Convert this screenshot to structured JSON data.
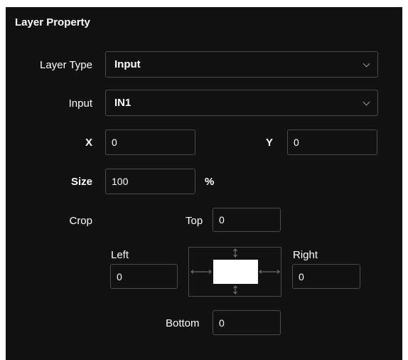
{
  "panel": {
    "title": "Layer Property"
  },
  "layer_type": {
    "label": "Layer Type",
    "value": "Input"
  },
  "input": {
    "label": "Input",
    "value": "IN1"
  },
  "x": {
    "label": "X",
    "value": "0"
  },
  "y": {
    "label": "Y",
    "value": "0"
  },
  "size": {
    "label": "Size",
    "value": "100",
    "unit": "%"
  },
  "crop": {
    "label": "Crop",
    "top": {
      "label": "Top",
      "value": "0"
    },
    "left": {
      "label": "Left",
      "value": "0"
    },
    "right": {
      "label": "Right",
      "value": "0"
    },
    "bottom": {
      "label": "Bottom",
      "value": "0"
    }
  },
  "icons": {
    "dropdown": "chevron-down-icon",
    "crop_handles": "arrow-handle-icon"
  },
  "colors": {
    "background": "#111111",
    "border": "#4a4a4a",
    "text": "#ffffff"
  }
}
